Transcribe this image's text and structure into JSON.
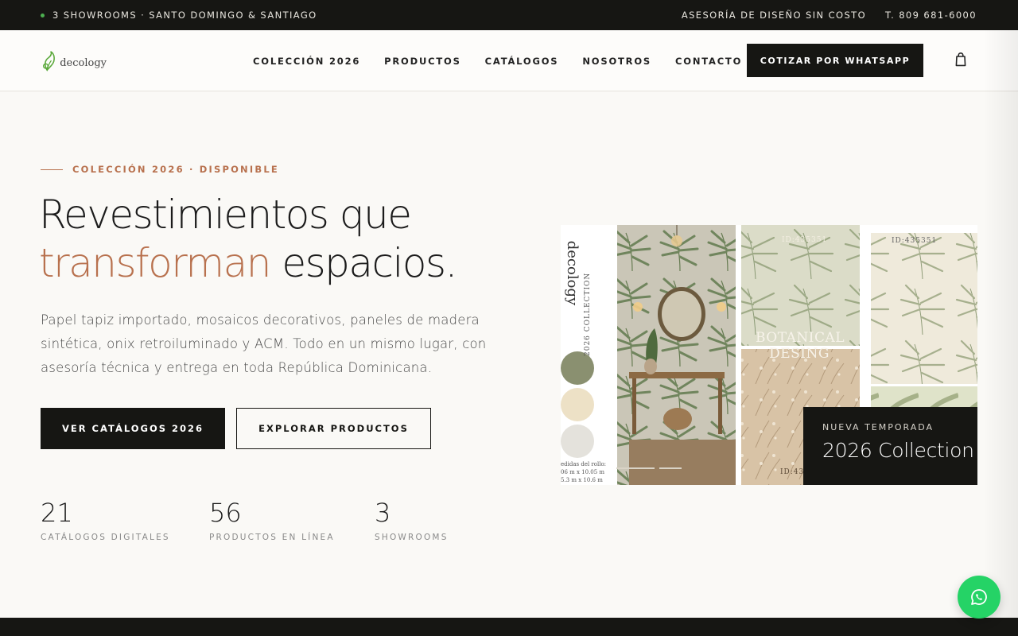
{
  "topbar": {
    "left_text": "3 SHOWROOMS · SANTO DOMINGO & SANTIAGO",
    "advisory": "ASESORÍA DE DISEÑO SIN COSTO",
    "phone": "T. 809 681-6000",
    "status_color": "#4caf50"
  },
  "header": {
    "logo_text": "decology",
    "nav": [
      "COLECCIÓN 2026",
      "PRODUCTOS",
      "CATÁLOGOS",
      "NOSOTROS",
      "CONTACTO"
    ],
    "cta": "COTIZAR POR WHATSAPP",
    "cart_icon": "shopping-bag-icon"
  },
  "hero": {
    "eyebrow": "COLECCIÓN 2026 · DISPONIBLE",
    "title_line1": "Revestimientos que",
    "title_accent": "transforman",
    "title_rest": " espacios.",
    "lead": "Papel tapiz importado, mosaicos decorativos, paneles de madera sintética, onix retroiluminado y ACM. Todo en un mismo lugar, con asesoría técnica y entrega en toda República Dominicana.",
    "btn_primary": "VER CATÁLOGOS 2026",
    "btn_secondary": "EXPLORAR PRODUCTOS",
    "accent_color": "#b8714e"
  },
  "stats": [
    {
      "num": "21",
      "label": "CATÁLOGOS DIGITALES"
    },
    {
      "num": "56",
      "label": "PRODUCTOS EN LÍNEA"
    },
    {
      "num": "3",
      "label": "SHOWROOMS"
    }
  ],
  "collage": {
    "brand_vertical": "decology",
    "collection_vertical": "2026 COLLECTION",
    "product_title_1": "BOTANICAL",
    "product_title_2": "DESING",
    "id_label": "ID:435351",
    "id_label_partial": "ID:43",
    "sizes_1": "edidas del rollo:",
    "sizes_2": "06 m x 10.05 m",
    "sizes_3": "5.3 m x 10.6 m",
    "swatches": [
      "#8a9070",
      "#ede1c6",
      "#e4e2dc"
    ]
  },
  "badge": {
    "kicker": "NUEVA TEMPORADA",
    "title": "2026 Collection"
  },
  "whatsapp_fab": {
    "icon": "whatsapp-icon",
    "color": "#25d366"
  }
}
